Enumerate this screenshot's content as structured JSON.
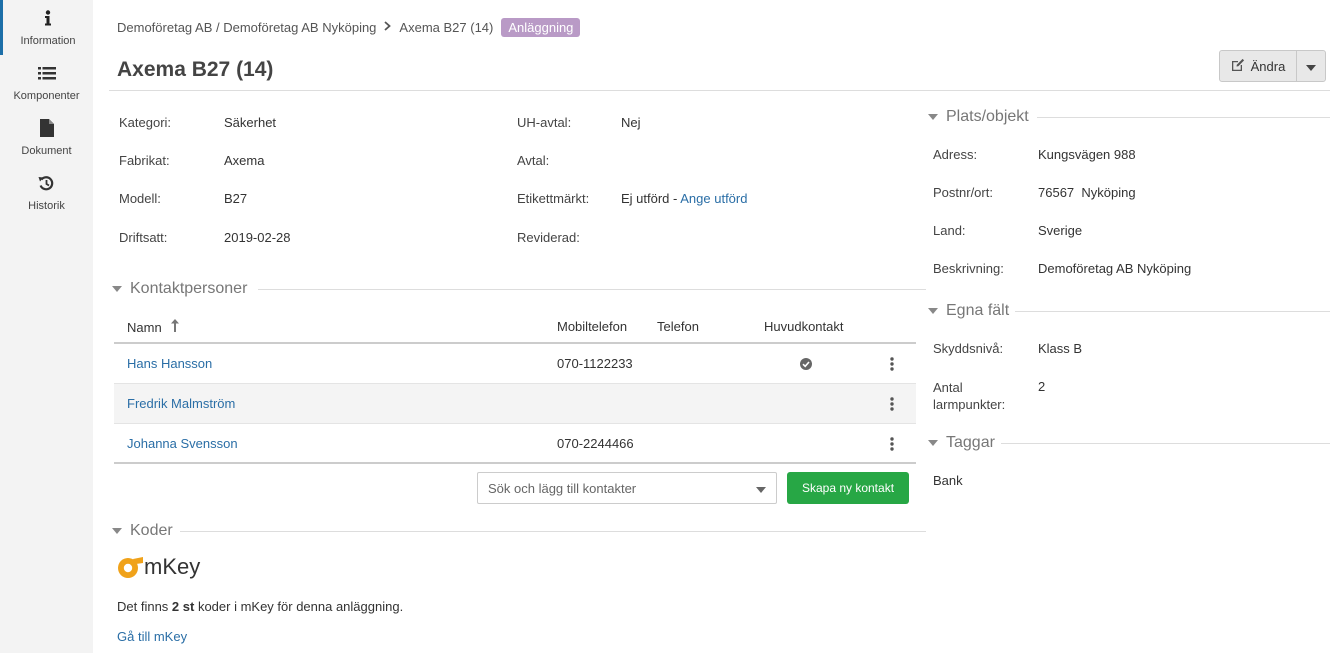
{
  "sidebar": {
    "items": [
      {
        "label": "Information",
        "icon": "info-icon"
      },
      {
        "label": "Komponenter",
        "icon": "list-icon"
      },
      {
        "label": "Dokument",
        "icon": "document-icon"
      },
      {
        "label": "Historik",
        "icon": "history-icon"
      }
    ]
  },
  "breadcrumb": {
    "path": "Demoföretag AB / Demoföretag AB Nyköping",
    "separator": ">",
    "current": "Axema B27 (14)",
    "badge": "Anläggning"
  },
  "title": "Axema B27 (14)",
  "edit_button": {
    "label": "Ändra"
  },
  "details": {
    "left": [
      {
        "label": "Kategori:",
        "value": "Säkerhet"
      },
      {
        "label": "Fabrikat:",
        "value": "Axema"
      },
      {
        "label": "Modell:",
        "value": "B27"
      },
      {
        "label": "Driftsatt:",
        "value": "2019-02-28"
      }
    ],
    "right": [
      {
        "label": "UH-avtal:",
        "value": "Nej"
      },
      {
        "label": "Avtal:",
        "value": ""
      },
      {
        "label": "Etikettmärkt:",
        "value": "Ej utförd - ",
        "link": "Ange utförd"
      },
      {
        "label": "Reviderad:",
        "value": ""
      }
    ]
  },
  "contacts": {
    "heading": "Kontaktpersoner",
    "columns": [
      "Namn",
      "Mobiltelefon",
      "Telefon",
      "Huvudkontakt"
    ],
    "rows": [
      {
        "name": "Hans Hansson",
        "mobile": "070-1122233",
        "phone": "",
        "main": true
      },
      {
        "name": "Fredrik Malmström",
        "mobile": "",
        "phone": "",
        "main": false
      },
      {
        "name": "Johanna Svensson",
        "mobile": "070-2244466",
        "phone": "",
        "main": false
      }
    ],
    "search_placeholder": "Sök och lägg till kontakter",
    "create_label": "Skapa ny kontakt"
  },
  "codes": {
    "heading": "Koder",
    "logo_text": "mKey",
    "text_before": "Det finns ",
    "count": "2 st",
    "text_after": " koder i mKey för denna anläggning.",
    "link": "Gå till mKey"
  },
  "place": {
    "heading": "Plats/objekt",
    "fields": [
      {
        "label": "Adress:",
        "value": "Kungsvägen 988"
      },
      {
        "label": "Postnr/ort:",
        "value": "76567  Nyköping"
      },
      {
        "label": "Land:",
        "value": "Sverige"
      },
      {
        "label": "Beskrivning:",
        "value": "Demoföretag AB Nyköping"
      }
    ]
  },
  "custom_fields": {
    "heading": "Egna fält",
    "fields": [
      {
        "label": "Skyddsnivå:",
        "value": "Klass B"
      },
      {
        "label": "Antal larmpunkter:",
        "value": "2"
      }
    ]
  },
  "tags": {
    "heading": "Taggar",
    "items": [
      "Bank"
    ]
  },
  "colors": {
    "accent": "#1c6fa8",
    "link": "#2a6ea6",
    "badge": "#b99ac6",
    "create_button": "#27a745",
    "logo_orange": "#f0a21a"
  }
}
